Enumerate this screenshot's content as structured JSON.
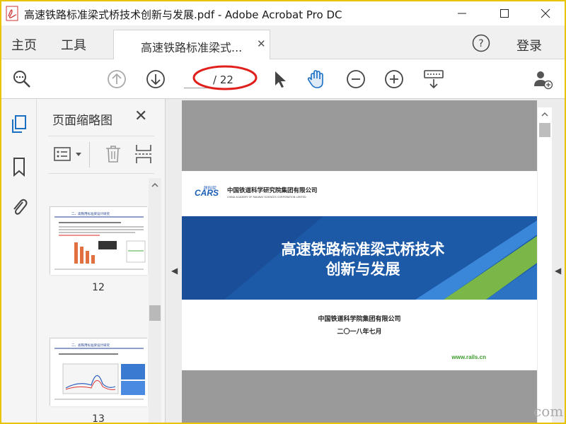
{
  "window": {
    "title": "高速铁路标准梁式桥技术创新与发展.pdf - Adobe Acrobat Pro DC",
    "app_icon": "acrobat-icon",
    "controls": [
      "minimize",
      "maximize",
      "close"
    ]
  },
  "menu": {
    "home": "主页",
    "tools": "工具",
    "doc_tab": "高速铁路标准梁式...",
    "help_icon": "help-icon",
    "login": "登录"
  },
  "toolbar": {
    "page_current": "",
    "page_total": "/ 22",
    "annotation_color": "#e0201c",
    "icons": [
      "zoom-search-icon",
      "prev-page-icon",
      "next-page-icon",
      "select-cursor-icon",
      "hand-tool-icon",
      "zoom-out-icon",
      "zoom-in-icon",
      "keyboard-icon",
      "add-user-icon"
    ]
  },
  "sidebar": {
    "icons": [
      "page-thumbnails-icon",
      "bookmark-icon",
      "attachment-icon"
    ]
  },
  "thumbnail_panel": {
    "title": "页面缩略图",
    "close": "✕",
    "tools": [
      "thumbnail-options-icon",
      "delete-icon",
      "crop-icon"
    ],
    "pages": [
      {
        "number": "12",
        "heading": "二、高铁用标准梁设计研究"
      },
      {
        "number": "13",
        "heading": "二、高铁用标准梁设计研究"
      }
    ]
  },
  "slide": {
    "logo_small": "铁科院",
    "logo_text": "CARS",
    "company_cn": "中国铁道科学研究院集团有限公司",
    "company_en": "CHINA ACADEMY OF RAILWAY SCIENCES CORPORATION LIMITED",
    "title_line1": "高速铁路标准梁式桥技术",
    "title_line2": "创新与发展",
    "org": "中国铁道科学院集团有限公司",
    "date": "二〇一八年七月",
    "url": "www.rails.cn"
  },
  "watermark": "com"
}
